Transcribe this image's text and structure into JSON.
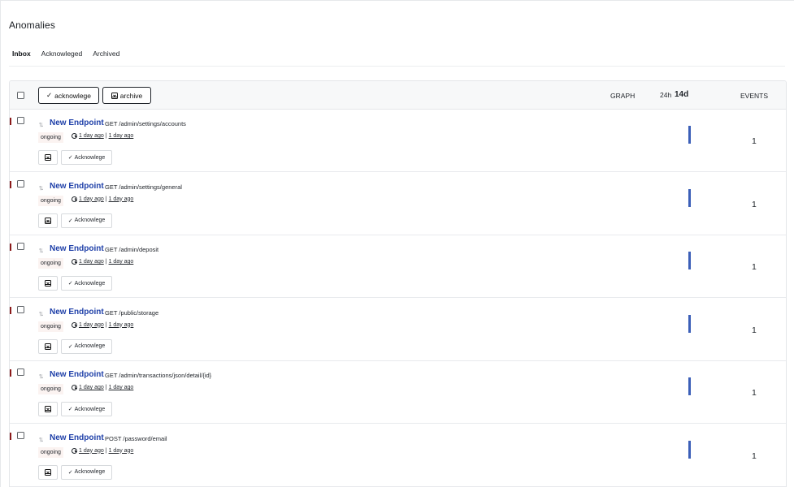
{
  "page_title": "Anomalies",
  "tabs": [
    {
      "label": "Inbox",
      "active": true
    },
    {
      "label": "Acknowleged",
      "active": false
    },
    {
      "label": "Archived",
      "active": false
    }
  ],
  "header": {
    "acknowledge_label": "acknowlege",
    "archive_label": "archive",
    "graph_label": "GRAPH",
    "range_24h": "24h",
    "range_14d": "14d",
    "selected_range": "14d",
    "events_label": "EVENTS"
  },
  "colors": {
    "accent": "#1e3fa8",
    "bar": "#3b5fb8",
    "severity": "#8b1a1a"
  },
  "rows": [
    {
      "name": "New Endpoint",
      "method_path": "GET /admin/settings/accounts",
      "status": "ongoing",
      "first_seen": "1 day ago",
      "last_seen": "1 day ago",
      "archive_icon": "archive-icon",
      "ack_label": "Acknowlege",
      "events": "1"
    },
    {
      "name": "New Endpoint",
      "method_path": "GET /admin/settings/general",
      "status": "ongoing",
      "first_seen": "1 day ago",
      "last_seen": "1 day ago",
      "archive_icon": "archive-icon",
      "ack_label": "Acknowlege",
      "events": "1"
    },
    {
      "name": "New Endpoint",
      "method_path": "GET /admin/deposit",
      "status": "ongoing",
      "first_seen": "1 day ago",
      "last_seen": "1 day ago",
      "archive_icon": "archive-icon",
      "ack_label": "Acknowlege",
      "events": "1"
    },
    {
      "name": "New Endpoint",
      "method_path": "GET /public/storage",
      "status": "ongoing",
      "first_seen": "1 day ago",
      "last_seen": "1 day ago",
      "archive_icon": "archive-icon",
      "ack_label": "Acknowlege",
      "events": "1"
    },
    {
      "name": "New Endpoint",
      "method_path": "GET /admin/transactions/json/detail/{id}",
      "status": "ongoing",
      "first_seen": "1 day ago",
      "last_seen": "1 day ago",
      "archive_icon": "archive-icon",
      "ack_label": "Acknowlege",
      "events": "1"
    },
    {
      "name": "New Endpoint",
      "method_path": "POST /password/email",
      "status": "ongoing",
      "first_seen": "1 day ago",
      "last_seen": "1 day ago",
      "archive_icon": "archive-icon",
      "ack_label": "Acknowlege",
      "events": "1"
    }
  ]
}
